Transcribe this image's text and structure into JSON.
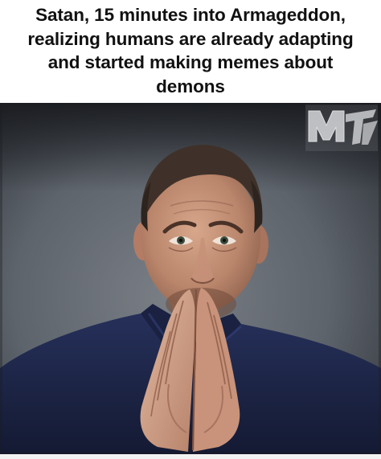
{
  "caption": {
    "line1": "Satan, 15 minutes into Armageddon,",
    "line2": "realizing humans are already adapting",
    "line3": "and started making memes about",
    "line4": "demons"
  },
  "logo": {
    "text": "MTV"
  },
  "colors": {
    "background": "#ffffff",
    "caption_text": "#111111",
    "photo_backdrop": "#5a6068",
    "shirt": "#1d2547",
    "skin": "#c28e74",
    "hair": "#4a3a30"
  }
}
